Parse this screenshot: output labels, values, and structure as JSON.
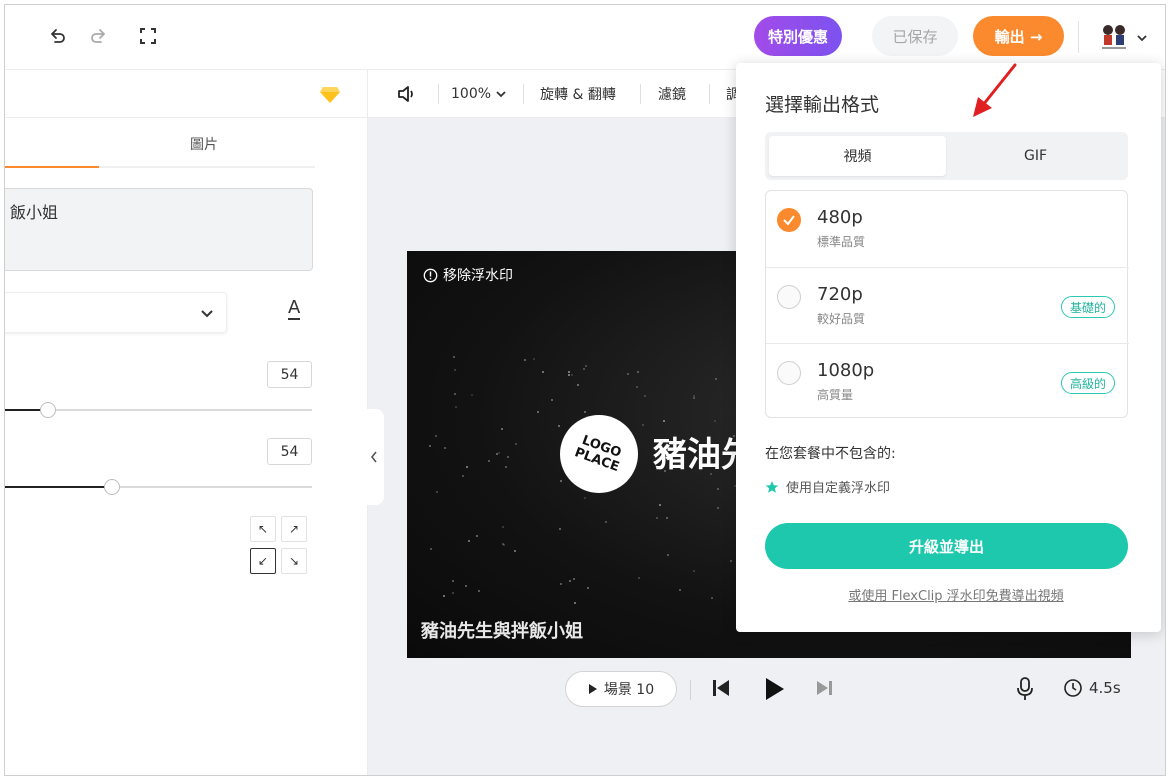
{
  "topbar": {
    "special_offer_label": "特別優惠",
    "saved_label": "已保存",
    "export_label": "輸出 →"
  },
  "left_panel": {
    "tab_image_label": "圖片",
    "text_content": "飯小姐",
    "font_size_1": "54",
    "font_size_2": "54",
    "slider1_level": 0.14,
    "slider2_level": 0.35
  },
  "toolbar": {
    "zoom_label": "100%",
    "rotate_flip_label": "旋轉 & 翻轉",
    "filter_label": "濾鏡",
    "partial_label": "調"
  },
  "canvas": {
    "remove_watermark_label": "移除浮水印",
    "logo_text": "LOGO PLACE",
    "title_text": "豬油先",
    "subtitle_text": "豬油先生與拌飯小姐"
  },
  "player": {
    "scene_label": "場景 10",
    "duration": "4.5s"
  },
  "export_dropdown": {
    "title": "選擇輸出格式",
    "tabs": [
      {
        "label": "視頻",
        "active": true
      },
      {
        "label": "GIF",
        "active": false
      }
    ],
    "resolutions": [
      {
        "name": "480p",
        "desc": "標準品質",
        "badge": "",
        "checked": true
      },
      {
        "name": "720p",
        "desc": "較好品質",
        "badge": "基礎的",
        "checked": false
      },
      {
        "name": "1080p",
        "desc": "高質量",
        "badge": "高級的",
        "checked": false
      }
    ],
    "not_included_label": "在您套餐中不包含的:",
    "feature_custom_watermark": "使用自定義浮水印",
    "upgrade_button_label": "升級並導出",
    "free_export_link": "或使用 FlexClip 浮水印免費導出視頻"
  },
  "colors": {
    "accent_orange": "#fb8a2e",
    "accent_teal": "#1ec8ad",
    "accent_purple": "#8b50ee",
    "annotation_red": "#e02020"
  }
}
